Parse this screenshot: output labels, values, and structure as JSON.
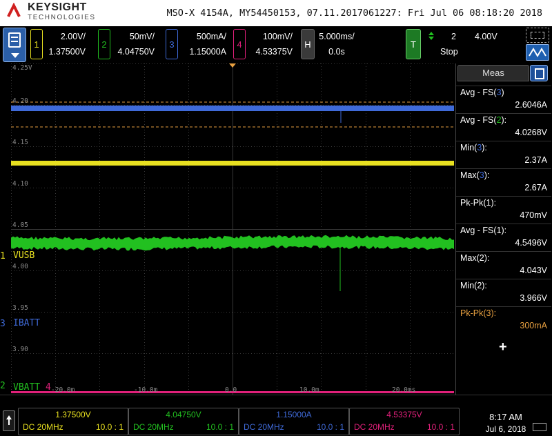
{
  "brand": {
    "name": "KEYSIGHT",
    "sub": "TECHNOLOGIES"
  },
  "header": {
    "title": "MSO-X 4154A, MY54450153, 07.11.2017061227: Fri Jul 06 08:18:20 2018"
  },
  "channels": [
    {
      "num": "1",
      "scale": "2.00V/",
      "offset": "1.37500V",
      "color": "#e8e020",
      "label": "VUSB"
    },
    {
      "num": "2",
      "scale": "50mV/",
      "offset": "4.04750V",
      "color": "#22c020",
      "label": "VBATT"
    },
    {
      "num": "3",
      "scale": "500mA/",
      "offset": "1.15000A",
      "color": "#3f6ad8",
      "label": "IBATT"
    },
    {
      "num": "4",
      "scale": "100mV/",
      "offset": "4.53375V",
      "color": "#e0207a",
      "label": ""
    }
  ],
  "horizontal": {
    "key": "H",
    "scale": "5.000ms/",
    "delay": "0.0s"
  },
  "trigger": {
    "key": "T",
    "source": "2",
    "level": "4.00V",
    "state": "Stop"
  },
  "colors": {
    "ch1": "#e8e020",
    "ch2": "#22c020",
    "ch3": "#3f6ad8",
    "ch4": "#e0207a",
    "cursor": "#e8a040",
    "grid": "#3a3a3a"
  },
  "y_axis_labels": [
    "4.25V",
    "4.20",
    "4.15",
    "4.10",
    "4.05",
    "4.00",
    "3.95",
    "3.90"
  ],
  "x_axis_labels": [
    "-20.0m",
    "-10.0m",
    "0.0",
    "10.0m",
    "20.0ms"
  ],
  "measurements": {
    "tab_label": "Meas",
    "items": [
      {
        "name_pre": "Avg - FS(",
        "src": "3",
        "name_post": ")",
        "value": "2.6046A",
        "src_color": "#3f6ad8",
        "name_color": "#ffffff",
        "value_color": "#ffffff"
      },
      {
        "name_pre": "Avg - FS(",
        "src": "2",
        "name_post": "):",
        "value": "4.0268V",
        "src_color": "#22c020",
        "name_color": "#ffffff",
        "value_color": "#ffffff"
      },
      {
        "name_pre": "Min(",
        "src": "3",
        "name_post": "):",
        "value": "2.37A",
        "src_color": "#3f6ad8",
        "name_color": "#ffffff",
        "value_color": "#ffffff"
      },
      {
        "name_pre": "Max(",
        "src": "3",
        "name_post": "):",
        "value": "2.67A",
        "src_color": "#3f6ad8",
        "name_color": "#ffffff",
        "value_color": "#ffffff"
      },
      {
        "name_pre": "Pk-Pk(",
        "src": "1",
        "name_post": "):",
        "value": "470mV",
        "src_color": "#ffffff",
        "name_color": "#ffffff",
        "value_color": "#ffffff"
      },
      {
        "name_pre": "Avg - FS(",
        "src": "1",
        "name_post": "):",
        "value": "4.5496V",
        "src_color": "#ffffff",
        "name_color": "#ffffff",
        "value_color": "#ffffff"
      },
      {
        "name_pre": "Max(",
        "src": "2",
        "name_post": "):",
        "value": "4.043V",
        "src_color": "#ffffff",
        "name_color": "#ffffff",
        "value_color": "#ffffff"
      },
      {
        "name_pre": "Min(",
        "src": "2",
        "name_post": "):",
        "value": "3.966V",
        "src_color": "#ffffff",
        "name_color": "#ffffff",
        "value_color": "#ffffff"
      },
      {
        "name_pre": "Pk-Pk(",
        "src": "3",
        "name_post": "):",
        "value": "300mA",
        "src_color": "#e8a040",
        "name_color": "#e8a040",
        "value_color": "#e8a040"
      }
    ],
    "add_label": "+"
  },
  "bottom": {
    "channels": [
      {
        "value": "1.37500V",
        "coupling": "DC 20MHz",
        "probe": "10.0 : 1",
        "color": "#e8e020"
      },
      {
        "value": "4.04750V",
        "coupling": "DC 20MHz",
        "probe": "10.0 : 1",
        "color": "#22c020"
      },
      {
        "value": "1.15000A",
        "coupling": "DC 20MHz",
        "probe": "10.0 : 1",
        "color": "#3f6ad8"
      },
      {
        "value": "4.53375V",
        "coupling": "DC 20MHz",
        "probe": "10.0 : 1",
        "color": "#e0207a"
      }
    ],
    "time": "8:17 AM",
    "date": "Jul 6, 2018"
  }
}
